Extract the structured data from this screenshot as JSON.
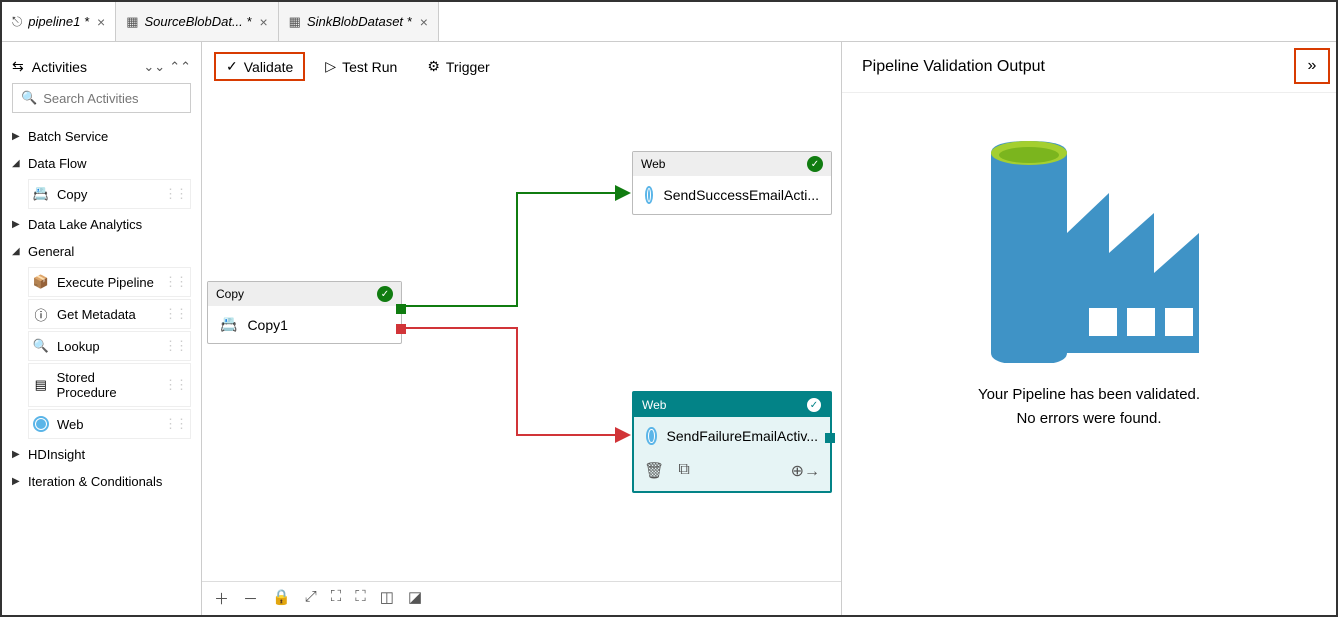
{
  "tabs": [
    {
      "icon": "⎋",
      "label": "pipeline1 *"
    },
    {
      "icon": "▦",
      "label": "SourceBlobDat... *"
    },
    {
      "icon": "▦",
      "label": "SinkBlobDataset *"
    }
  ],
  "sidebar": {
    "title": "Activities",
    "search_placeholder": "Search Activities",
    "groups": [
      {
        "label": "Batch Service",
        "expanded": false,
        "items": []
      },
      {
        "label": "Data Flow",
        "expanded": true,
        "items": [
          {
            "label": "Copy",
            "icon": "copy"
          }
        ]
      },
      {
        "label": "Data Lake Analytics",
        "expanded": false,
        "items": []
      },
      {
        "label": "General",
        "expanded": true,
        "items": [
          {
            "label": "Execute Pipeline",
            "icon": "pipe"
          },
          {
            "label": "Get Metadata",
            "icon": "info"
          },
          {
            "label": "Lookup",
            "icon": "lookup"
          },
          {
            "label": "Stored Procedure",
            "icon": "sp"
          },
          {
            "label": "Web",
            "icon": "web"
          }
        ]
      },
      {
        "label": "HDInsight",
        "expanded": false,
        "items": []
      },
      {
        "label": "Iteration & Conditionals",
        "expanded": false,
        "items": []
      }
    ]
  },
  "toolbar": {
    "validate": "Validate",
    "testrun": "Test Run",
    "trigger": "Trigger"
  },
  "nodes": {
    "copy": {
      "type": "Copy",
      "name": "Copy1"
    },
    "success": {
      "type": "Web",
      "name": "SendSuccessEmailActi..."
    },
    "failure": {
      "type": "Web",
      "name": "SendFailureEmailActiv..."
    }
  },
  "right": {
    "title": "Pipeline Validation Output",
    "msg1": "Your Pipeline has been validated.",
    "msg2": "No errors were found."
  }
}
